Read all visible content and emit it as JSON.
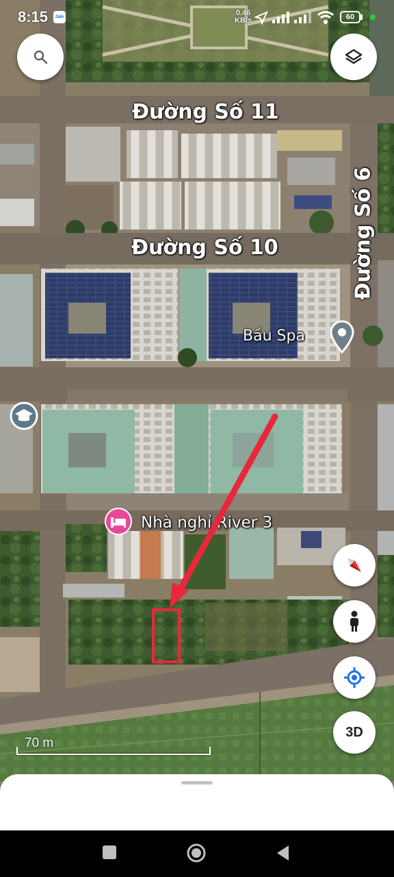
{
  "status_bar": {
    "time": "8:15",
    "notif_icon_label": "Zalo",
    "network_speed_value": "0.46",
    "network_speed_unit": "KB/s",
    "battery": "60"
  },
  "map": {
    "streets": [
      {
        "id": "duong-so-11",
        "label": "Đường Số 11"
      },
      {
        "id": "duong-so-10",
        "label": "Đường Số 10"
      },
      {
        "id": "duong-so-6",
        "label": "Đường Số 6"
      }
    ],
    "places": [
      {
        "id": "bau-spa",
        "label": "Bầu Spa",
        "icon": "location-pin-icon"
      },
      {
        "id": "nha-nghi-river-3",
        "label": "Nhà nghỉ River 3",
        "icon": "hotel-bed-icon",
        "color": "#e8489a"
      },
      {
        "id": "school",
        "label": "",
        "icon": "graduation-cap-icon"
      }
    ],
    "scale_label": "70 m",
    "annotation": {
      "arrow_color": "#e8283a",
      "box_color": "#e8283a"
    }
  },
  "controls": {
    "search": "search-icon",
    "layers": "layers-icon",
    "compass": "compass-icon",
    "street_view": "pegman-icon",
    "my_location": "my-location-icon",
    "view_3d_label": "3D"
  },
  "nav": {
    "recent": "square-icon",
    "home": "circle-icon",
    "back": "triangle-back-icon"
  }
}
